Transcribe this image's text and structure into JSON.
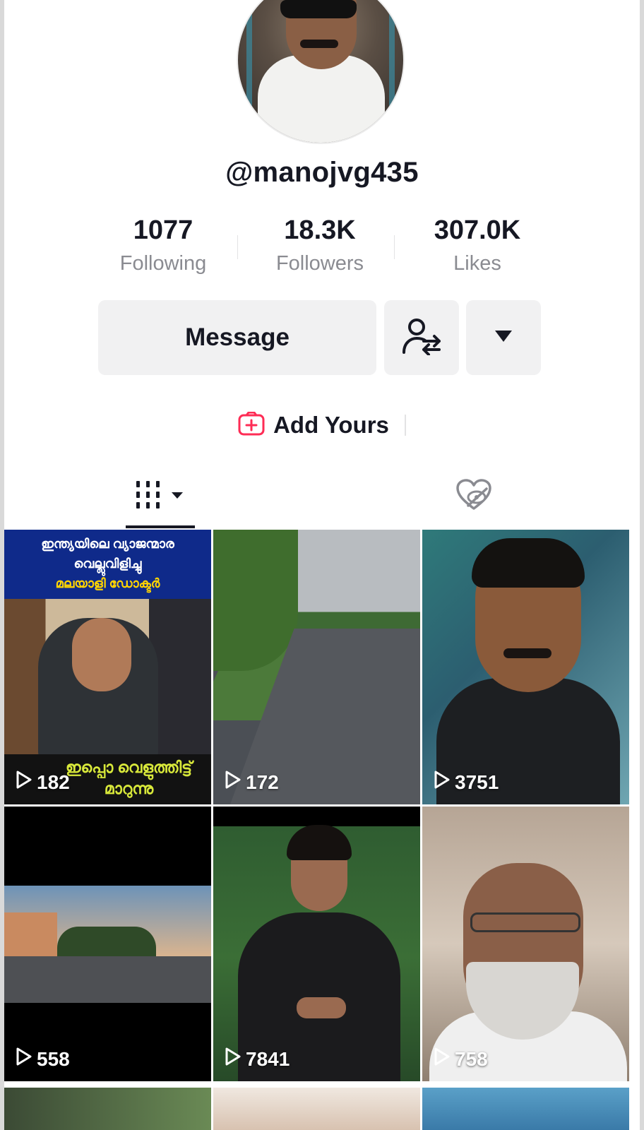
{
  "profile": {
    "username": "@manojvg435",
    "stats": [
      {
        "value": "1077",
        "label": "Following"
      },
      {
        "value": "18.3K",
        "label": "Followers"
      },
      {
        "value": "307.0K",
        "label": "Likes"
      }
    ],
    "message_label": "Message",
    "add_yours_label": "Add Yours"
  },
  "thumbnail_text": {
    "banner_line_1": "ഇന്ത്യയിലെ വ്യാജന്മാര",
    "banner_line_2": "വെല്ലുവിളിച്ചു",
    "banner_line_3": "മലയാളി ഡോക്ടർ",
    "caption": "ഇപ്പൊ വെളുത്തിട്ട് മാറുന്നു"
  },
  "videos": [
    {
      "views": "182"
    },
    {
      "views": "172"
    },
    {
      "views": "3751"
    },
    {
      "views": "558"
    },
    {
      "views": "7841"
    },
    {
      "views": "758"
    }
  ],
  "colors": {
    "accent": "#fe2c55",
    "text": "#161823",
    "muted": "#8a8b91",
    "button_bg": "#f1f1f2"
  },
  "icons": {
    "friend_button": "person-swap-icon",
    "more_button": "caret-down-icon",
    "add_yours": "plus-square-icon",
    "videos_tab": "grid-columns-icon",
    "liked_tab": "heart-hidden-icon",
    "play": "play-outline-icon"
  }
}
